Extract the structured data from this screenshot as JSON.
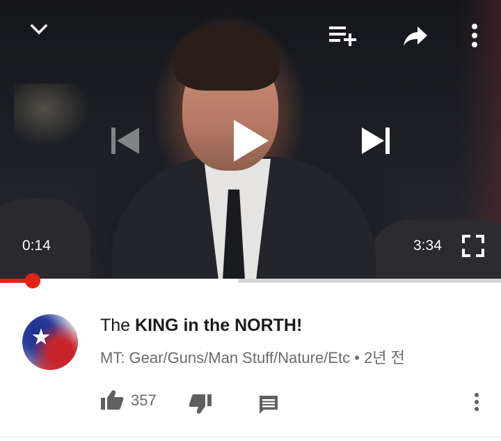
{
  "player": {
    "current_time": "0:14",
    "duration": "3:34",
    "played_fraction": 0.065,
    "buffered_fraction": 0.475,
    "state": "paused",
    "top_controls": [
      "chevron-down-icon",
      "add-to-playlist-icon",
      "share-icon",
      "more-vert-icon"
    ],
    "center_controls": [
      "previous-icon",
      "play-icon",
      "next-icon"
    ],
    "accent_color": "#e62117"
  },
  "video": {
    "title_prefix": "The ",
    "title_bold": "KING in the NORTH!",
    "channel": "MT: Gear/Guns/Man Stuff/Nature/Etc",
    "separator": "•",
    "age": "2년 전"
  },
  "actions": {
    "like_count": "357",
    "icons": [
      "thumb-up-icon",
      "thumb-down-icon",
      "comment-icon",
      "more-vert-icon"
    ]
  }
}
